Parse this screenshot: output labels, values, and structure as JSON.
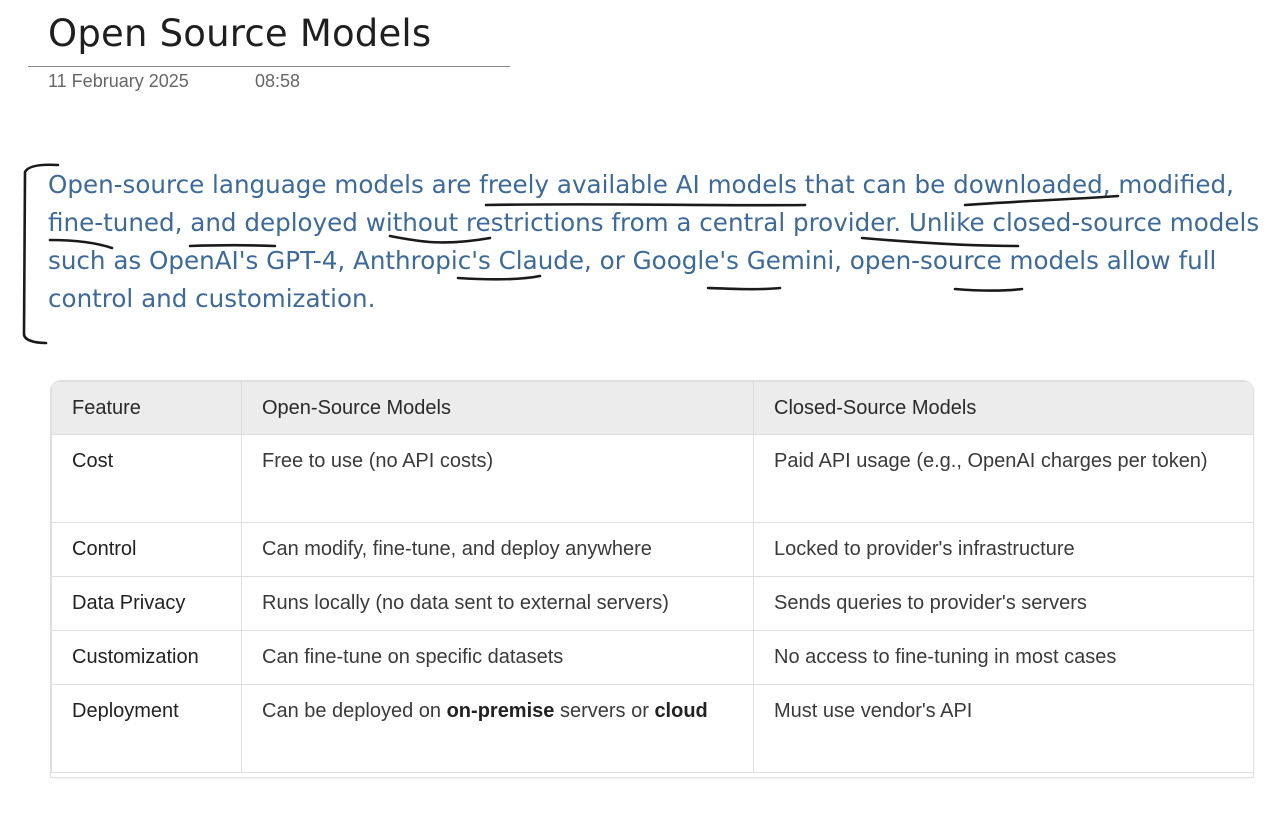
{
  "page": {
    "title": "Open Source Models",
    "date": "11 February 2025",
    "time": "08:58"
  },
  "intro": {
    "text": "Open-source language models are freely available AI models that can be downloaded, modified, fine-tuned, and deployed without restrictions from a central provider. Unlike closed-source models such as OpenAI's GPT-4, Anthropic's Claude, or Google's Gemini, open-source models allow full control and customization.",
    "ink_color": "#1a1a1a"
  },
  "table": {
    "headers": [
      "Feature",
      "Open-Source Models",
      "Closed-Source Models"
    ],
    "rows": [
      {
        "feature": "Cost",
        "open": "Free to use (no API costs)",
        "closed": "Paid API usage (e.g., OpenAI charges per token)"
      },
      {
        "feature": "Control",
        "open": "Can modify, fine-tune, and deploy anywhere",
        "closed": "Locked to provider's infrastructure"
      },
      {
        "feature": "Data Privacy",
        "open": "Runs locally (no data sent to external servers)",
        "closed": "Sends queries to provider's servers"
      },
      {
        "feature": "Customization",
        "open": "Can fine-tune on specific datasets",
        "closed": "No access to fine-tuning in most cases"
      },
      {
        "feature": "Deployment",
        "open_parts": [
          "Can be deployed on ",
          "on-premise",
          " servers or ",
          "cloud"
        ],
        "closed": "Must use vendor's API"
      }
    ]
  },
  "colors": {
    "paragraph_text": "#3d6a98",
    "header_bg": "#ececec",
    "grid": "#dedede"
  }
}
